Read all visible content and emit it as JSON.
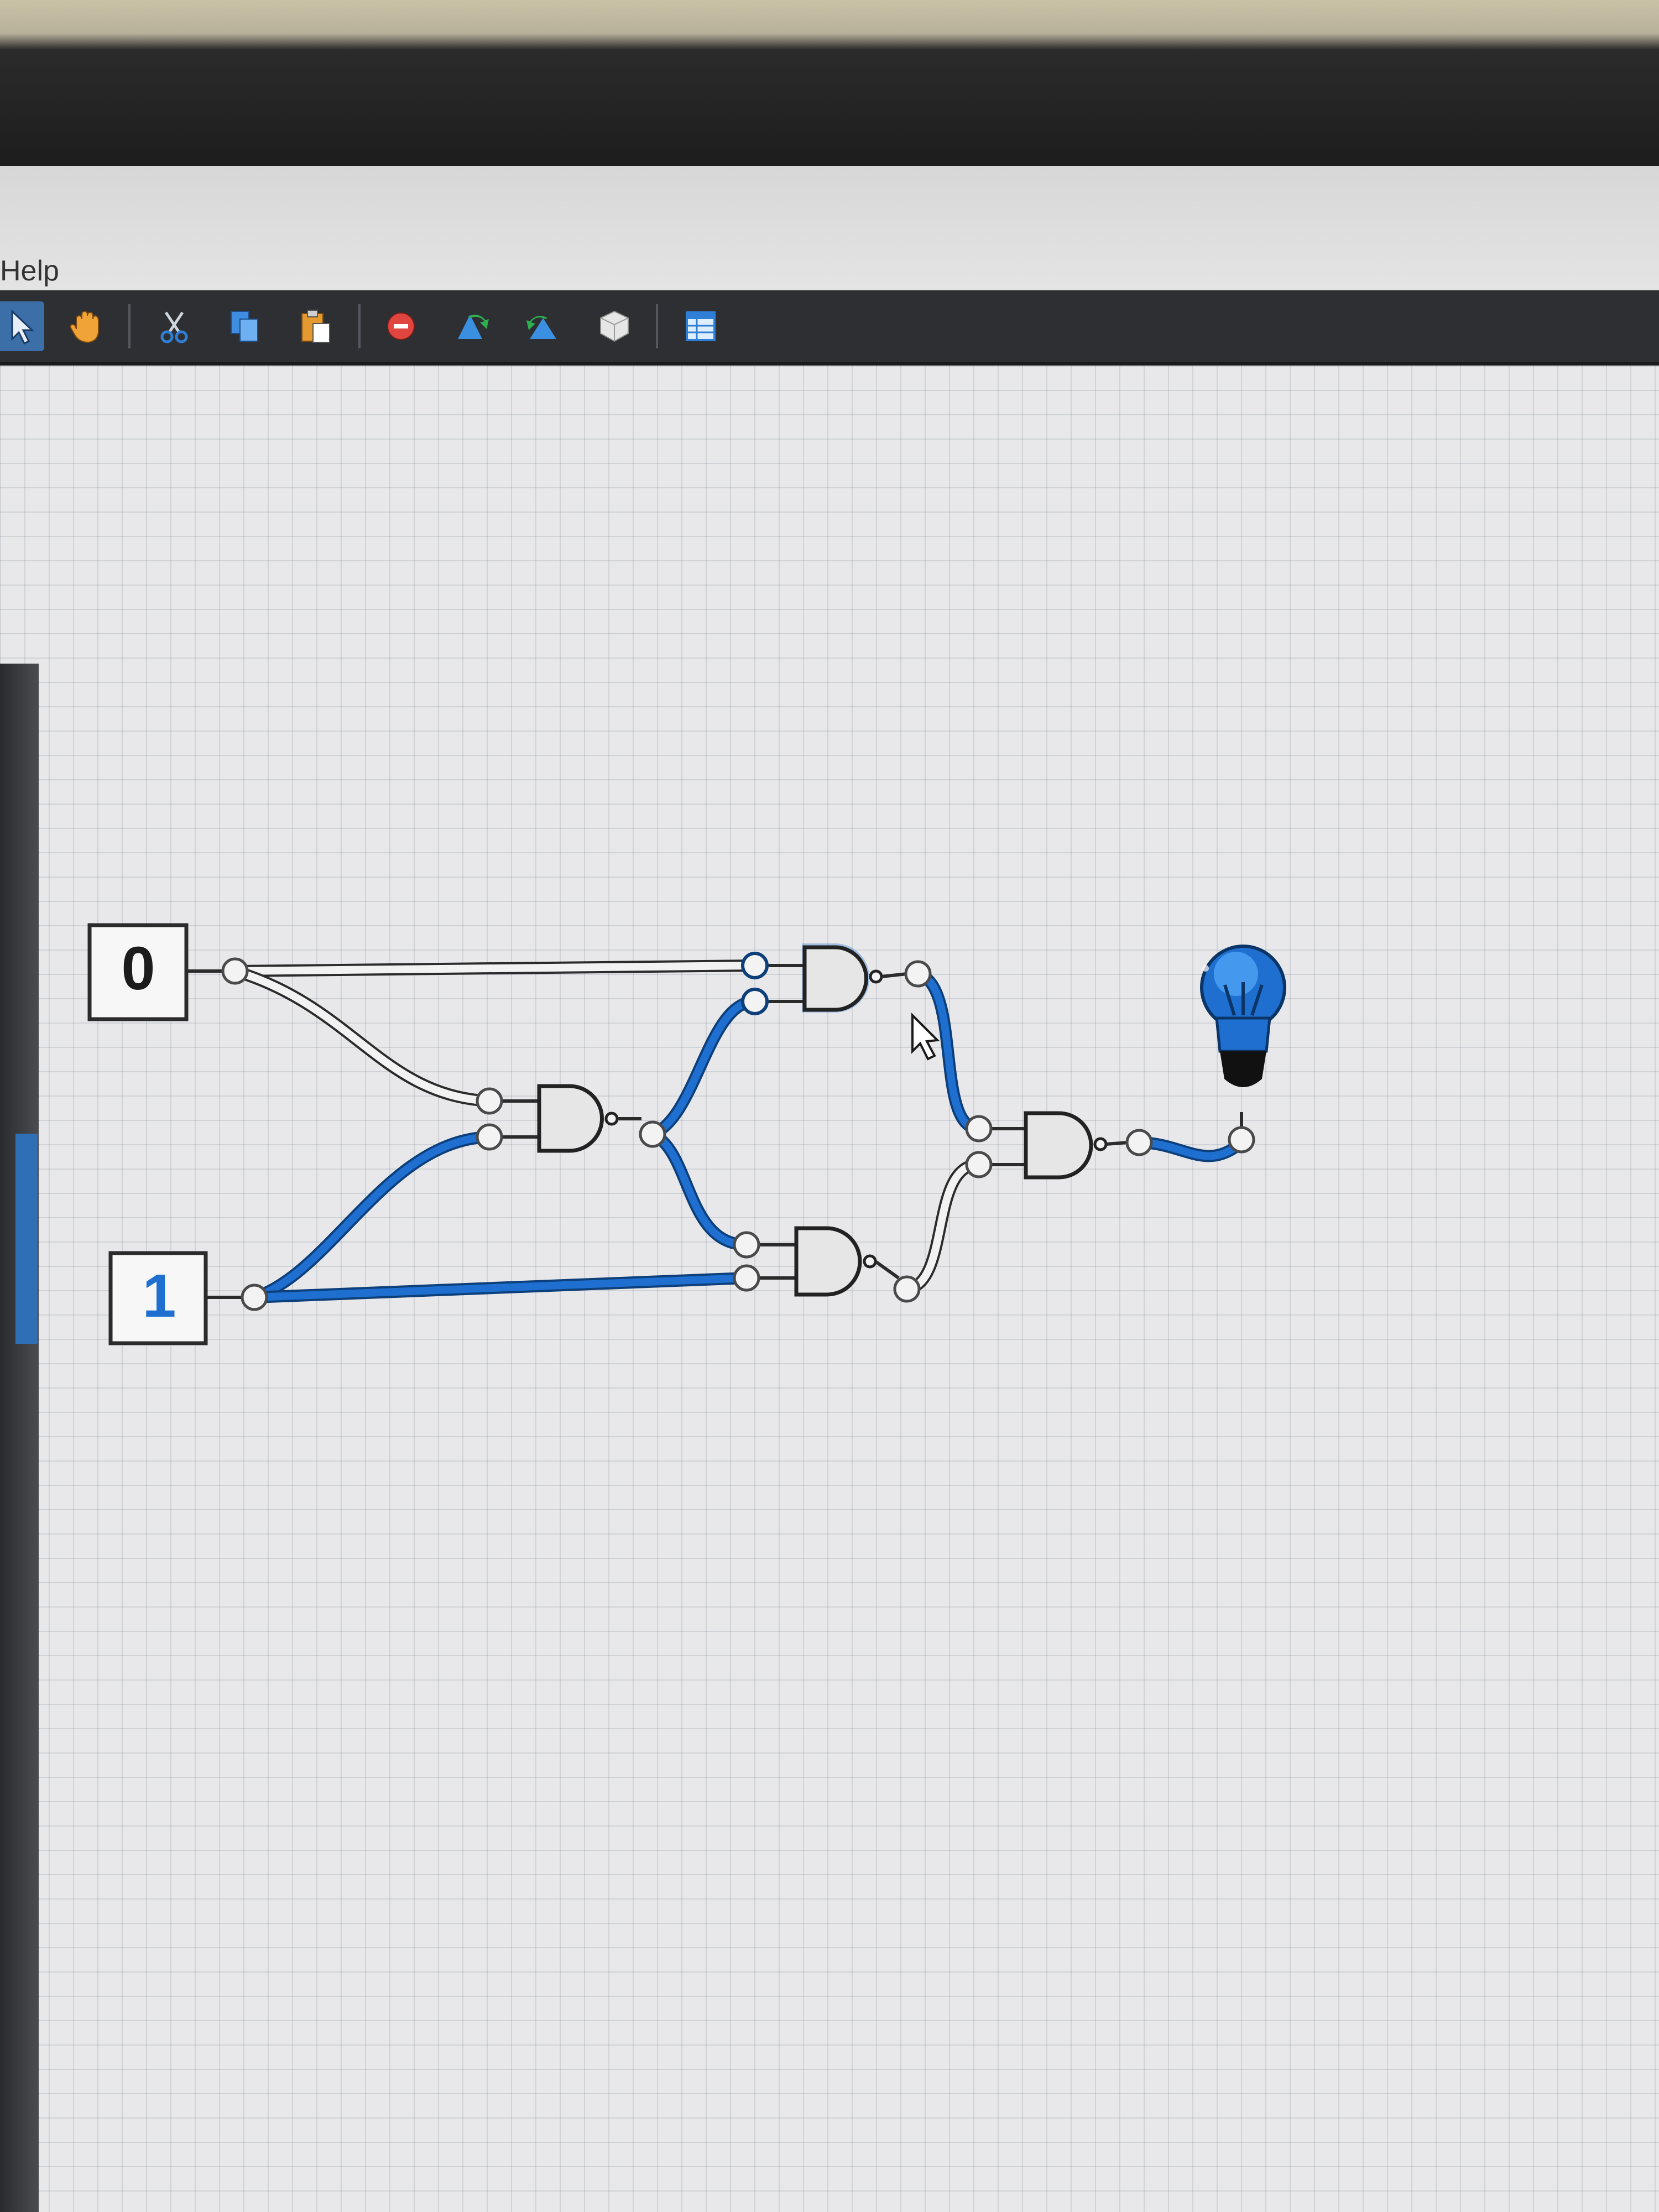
{
  "menu": {
    "help_label": "Help"
  },
  "toolbar": {
    "tools": [
      {
        "icon": "select-pointer-icon",
        "active": true
      },
      {
        "icon": "hand-pan-icon"
      },
      {
        "icon": "cut-scissors-icon"
      },
      {
        "icon": "copy-icon"
      },
      {
        "icon": "paste-icon"
      },
      {
        "icon": "delete-icon"
      },
      {
        "icon": "undo-icon"
      },
      {
        "icon": "redo-icon"
      },
      {
        "icon": "component-cube-icon"
      },
      {
        "icon": "table-icon"
      }
    ]
  },
  "circuit": {
    "input_a_value": "0",
    "input_b_value": "1",
    "wire_on_color": "#1565c0",
    "wire_off_color": "#f2f2f2",
    "gates": [
      "nand-gate-1",
      "nand-gate-2",
      "nand-gate-3",
      "nand-gate-4"
    ],
    "output": {
      "icon": "light-bulb-icon",
      "state": "on"
    }
  }
}
